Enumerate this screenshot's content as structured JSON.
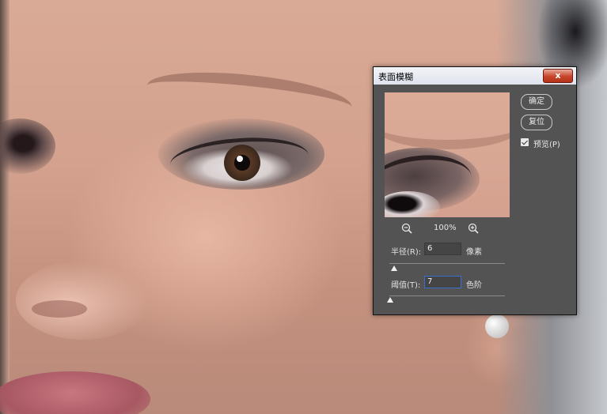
{
  "dialog": {
    "title": "表面模糊",
    "close_glyph": "x",
    "ok_label": "确定",
    "reset_label": "复位",
    "preview_label": "预览(P)",
    "preview_checked": true,
    "zoom_level": "100%",
    "radius": {
      "label": "半径(R):",
      "value": "6",
      "unit": "像素",
      "slider_fraction": 0.02
    },
    "threshold": {
      "label": "阈值(T):",
      "value": "7",
      "unit": "色阶",
      "slider_fraction": 0.0
    }
  },
  "icons": {
    "zoom_out": "zoom-out-icon",
    "zoom_in": "zoom-in-icon",
    "close": "close-icon",
    "checkbox": "checkmark-icon"
  },
  "colors": {
    "dialog_bg": "#535353",
    "title_bar": "#e8ebf3",
    "close_button": "#c7442b",
    "focus_border": "#3a6fd0"
  }
}
